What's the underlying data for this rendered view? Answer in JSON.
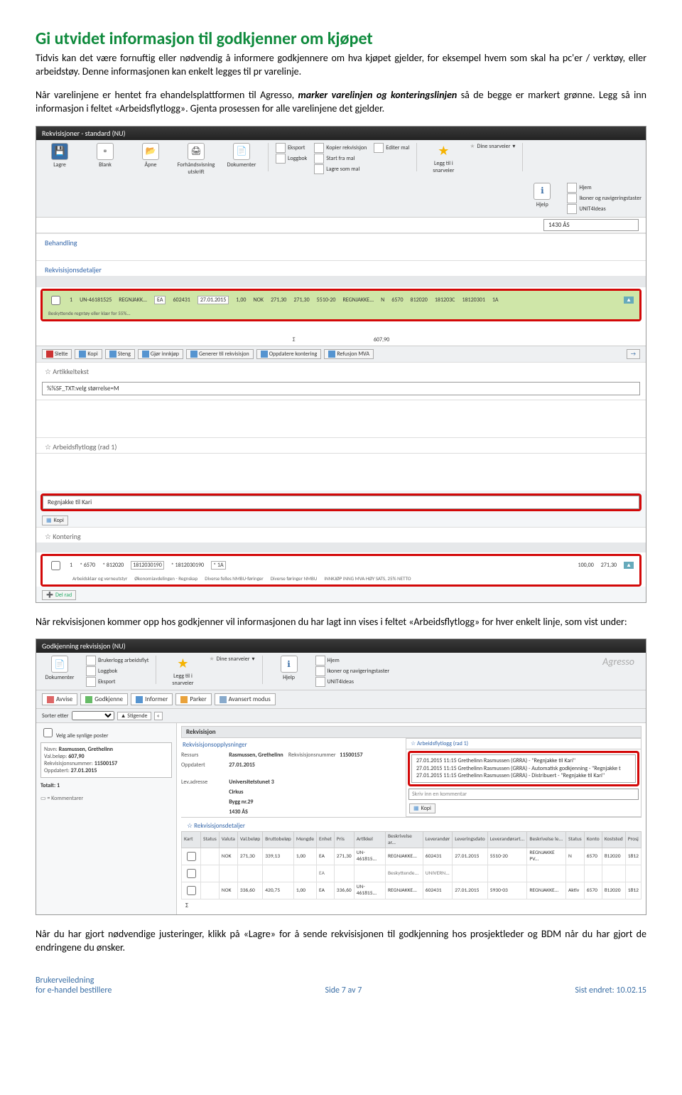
{
  "heading": "Gi utvidet informasjon til godkjenner om kjøpet",
  "para1": "Tidvis kan det være fornuftig eller nødvendig å informere godkjennere om hva kjøpet gjelder, for eksempel hvem som skal ha pc'er / verktøy, eller arbeidstøy. Denne informasjonen kan enkelt legges til pr varelinje.",
  "para2a": "Når varelinjene er hentet fra ehandelsplattformen til Agresso, ",
  "para2b": "marker varelinjen og konteringslinjen",
  "para2c": " så de begge er markert grønne. Legg så inn informasjon i feltet «Arbeidsflytlogg». Gjenta prosessen for alle varelinjene det gjelder.",
  "para3": "Når rekvisisjonen kommer opp hos godkjenner vil informasjonen du har lagt inn vises i feltet «Arbeidsflytlogg» for hver enkelt linje, som vist under:",
  "para4": "Når du har gjort nødvendige justeringer, klikk på «Lagre» for å sende rekvisisjonen til godkjenning hos prosjektleder og BDM når du har gjort de endringene du ønsker.",
  "s1": {
    "title": "Rekvisisjoner - standard (NU)",
    "toolbar": {
      "lagre": "Lagre",
      "blank": "Blank",
      "apne": "Åpne",
      "forhand": "Forhåndsvisning utskrift",
      "dok": "Dokumenter",
      "eksport": "Eksport",
      "loggbok": "Loggbok",
      "kopier": "Kopier rekvisisjon",
      "startfra": "Start fra mal",
      "lagresom": "Lagre som mal",
      "editer": "Editer mal",
      "leggtil": "Legg til i snarveier",
      "snarveier": "Dine snarveier",
      "hjem": "Hjem",
      "ikoner": "Ikoner og navigeringstaster",
      "unit4": "UNIT4Ideas",
      "hjelp": "Hjelp"
    },
    "addr": "1430 ÅS",
    "behandling": "Behandling",
    "rekdet": "Rekvisisjonsdetaljer",
    "row1": {
      "n": "1",
      "art": "UN-46181525",
      "besk": "REGNJAKK...",
      "ea": "EA",
      "lev": "602431",
      "dato": "27.01.2015",
      "m": "1,00",
      "val": "NOK",
      "pris": "271,30",
      "bel": "271,30",
      "kat": "5510-20",
      "besk2": "REGNJAKKE...",
      "st": "N",
      "k": "6570",
      "ks": "812020",
      "pr": "181203C",
      "ao": "18120301",
      "ak": "1A",
      "sub": "Beskyttende regntøy eller klær for 55%..."
    },
    "row2_sum": "607,90",
    "btns": {
      "slette": "Slette",
      "kopi": "Kopi",
      "steng": "Steng",
      "gjor": "Gjør innkjøp",
      "generer": "Generer til rekvisisjon",
      "oppdater": "Oppdatere kontering",
      "refusjon": "Refusjon MVA"
    },
    "artikkel": "Artikkeltekst",
    "artval": "%%SF_TXT:velg størrelse=M",
    "arbeid": "Arbeidsflytlogg (rad 1)",
    "regnjakke": "Regnjakke til Kari",
    "kopi": "Kopi",
    "kontering": "Kontering",
    "krow": {
      "n": "1",
      "konto": "6570",
      "ksub": "Arbeidsklær og verneutstyr",
      "kost": "812020",
      "kosub": "Økonomiavdelingen - Regnskap",
      "pros": "1812030190",
      "psub": "Diverse felles NMBU-føringer",
      "arb": "1812030190",
      "asub": "Diverse føringer NMBU",
      "ak": "1A",
      "aksub": "INNKJØP INNG MVA HØY SATS, 25% NETTO",
      "pct": "100,00",
      "bel": "271,30"
    },
    "delrad": "Del rad"
  },
  "s2": {
    "title": "Godkjenning rekvisisjon (NU)",
    "toolbar": {
      "dok": "Dokumenter",
      "bruker": "Brukerlogg arbeidsflyt",
      "loggbok": "Loggbok",
      "eksport": "Eksport",
      "leggtil": "Legg til i snarveier",
      "snarveier": "Dine snarveier",
      "hjem": "Hjem",
      "ikoner": "Ikoner og navigeringstaster",
      "unit4": "UNIT4Ideas",
      "hjelp": "Hjelp"
    },
    "actions": {
      "avvise": "Avvise",
      "godkjenne": "Godkjenne",
      "informer": "Informer",
      "parker": "Parker",
      "avansert": "Avansert modus"
    },
    "sorter": "Sorter etter",
    "stigende": "Stigende",
    "velg": "Velg alle synlige poster",
    "left": {
      "navn_l": "Navn:",
      "navn_v": "Rasmussen, Grethelinn",
      "val_l": "Val.beløp:",
      "val_v": "607,90",
      "rek_l": "Rekvisisjonsnummer:",
      "rek_v": "11500157",
      "opp_l": "Oppdatert:",
      "opp_v": "27.01.2015",
      "tot_l": "Totalt: 1",
      "komm": "= Kommentarer"
    },
    "rek": "Rekvisisjon",
    "rekopl": "Rekvisisjonsopplysninger",
    "info": {
      "ressurs_l": "Ressurs",
      "ressurs_v": "Rasmussen, Grethelinn",
      "reknr_l": "Rekvisisjonsnummer",
      "reknr_v": "11500157",
      "opp_l": "Oppdatert",
      "opp_v": "27.01.2015",
      "lev_l": "Lev.adresse",
      "lev_v1": "Universitetstunet 3",
      "lev_v2": "Cirkus",
      "lev_v3": "Bygg nr.29",
      "lev_v4": "1430 ÅS"
    },
    "arb_hdr": "Arbeidsflytlogg (rad 1)",
    "arb_l1": "27.01.2015 11:15 Grethelinn Rasmussen (GRRA) - \"Regnjakke til Kari\"",
    "arb_l2": "27.01.2015 11:15 Grethelinn Rasmussen (GRRA) - Automatisk godkjenning - \"Regnjakke t",
    "arb_l3": "27.01.2015 11:15 Grethelinn Rasmussen (GRRA) - Distribuert - \"Regnjakke til Kari\"",
    "skriv": "Skriv inn en kommentar",
    "kopi": "Kopi",
    "rekdet": "Rekvisisjonsdetaljer",
    "th": [
      "Kart",
      "Status",
      "Valuta",
      "Val.beløp",
      "Bruttobeløp",
      "Mengde",
      "Enhet",
      "Pris",
      "Artikkel",
      "Beskrivelse ar...",
      "Leverandør",
      "Leveringsdato",
      "Leverandørart...",
      "Beskrivelse le...",
      "Status",
      "Konto",
      "Koststed",
      "Prosj"
    ],
    "tr1": [
      "",
      "",
      "NOK",
      "271,30",
      "339,13",
      "1,00",
      "EA",
      "271,30",
      "UN-461815...",
      "REGNJAKKE...",
      "602431",
      "27.01.2015",
      "5510-20",
      "REGNJAKKE PV...",
      "N",
      "6570",
      "812020",
      "1812"
    ],
    "tr1b": [
      "",
      "",
      "",
      "",
      "",
      "",
      "EA",
      "",
      "",
      "Beskyttende...",
      "UNIVERN...",
      "",
      "",
      "",
      "",
      "",
      "",
      ""
    ],
    "tr2": [
      "",
      "",
      "NOK",
      "336,60",
      "420,75",
      "1,00",
      "EA",
      "336,60",
      "UN-461815...",
      "REGNJAKKE...",
      "602431",
      "27.01.2015",
      "5930-03",
      "REGNJAKKE...",
      "Aktiv",
      "6570",
      "812020",
      "1812"
    ]
  },
  "footer": {
    "l1": "Brukerveiledning",
    "l2": "for e-handel bestillere",
    "c": "Side 7 av 7",
    "r": "Sist endret: 10.02.15"
  }
}
